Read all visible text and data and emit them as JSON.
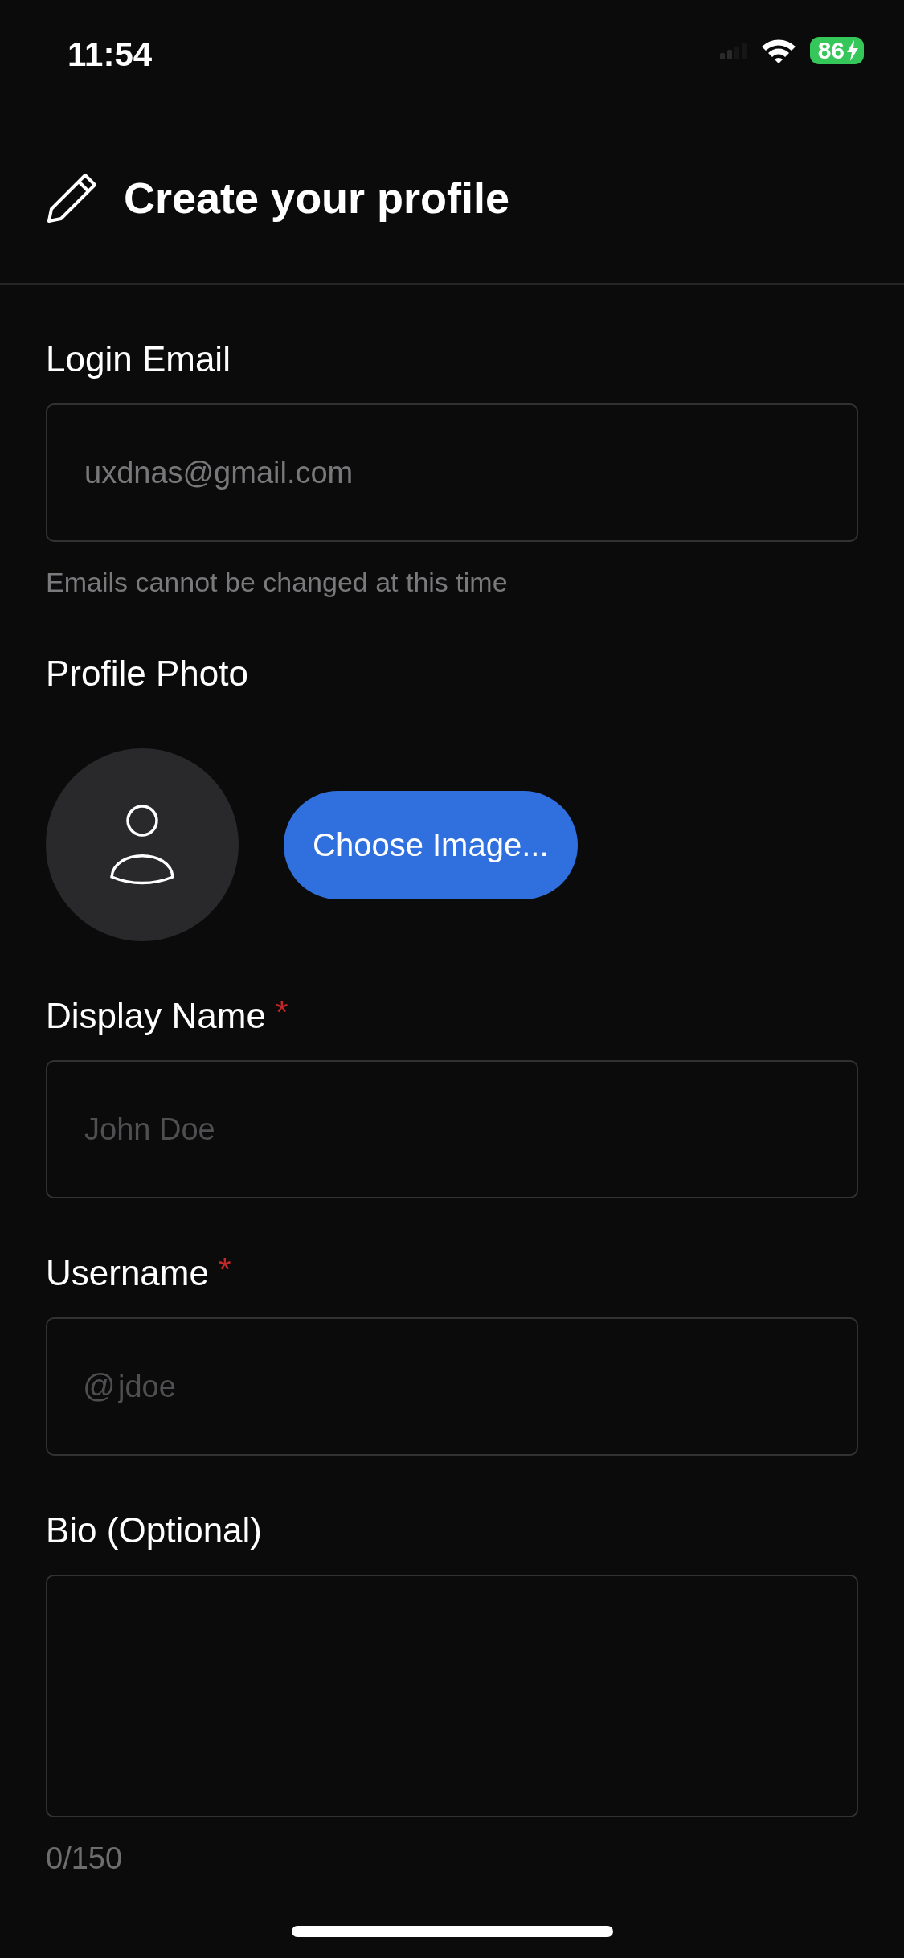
{
  "status_bar": {
    "time": "11:54",
    "battery": "86"
  },
  "header": {
    "title": "Create your profile"
  },
  "sections": [
    {
      "kind": "field",
      "label": "Login Email",
      "value": "uxdnas@gmail.com",
      "disabled": true,
      "hint": "Emails cannot be changed at this time"
    },
    {
      "kind": "photo",
      "label": "Profile Photo",
      "button": "Choose Image..."
    },
    {
      "kind": "field",
      "label": "Display Name",
      "required_mark": "*",
      "placeholder": "John Doe"
    },
    {
      "kind": "field",
      "label": "Username",
      "required_mark": "*",
      "prefix": "@",
      "placeholder": "jdoe"
    },
    {
      "kind": "textarea",
      "label": "Bio (Optional)",
      "counter": "0/150"
    }
  ]
}
